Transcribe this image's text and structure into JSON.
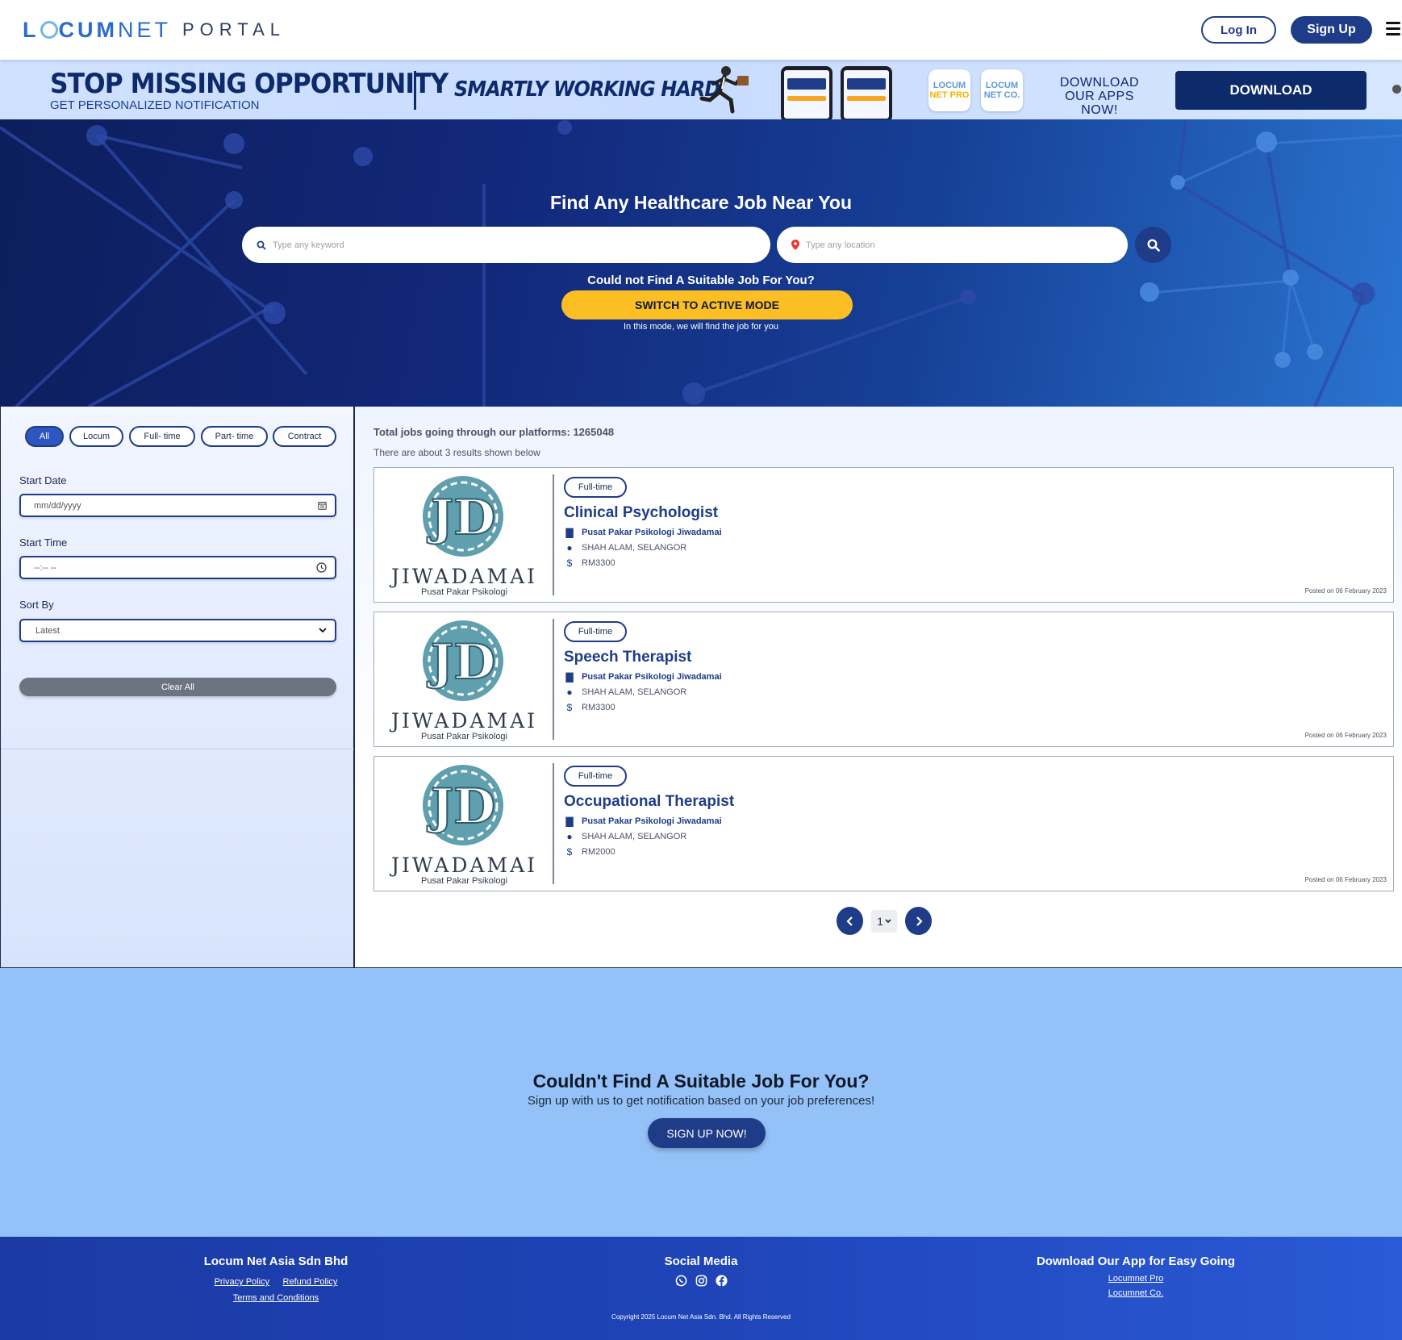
{
  "navbar": {
    "logo_locum": "L CUM",
    "logo_net": "NET",
    "logo_portal": "PORTAL",
    "login_label": "Log In",
    "signup_label": "Sign Up"
  },
  "promo": {
    "headline": "STOP MISSING OPPORTUNITY",
    "subline": "GET PERSONALIZED NOTIFICATION",
    "tagline": "SMARTLY WORKING HARD",
    "app1_line1": "LOCUM",
    "app1_line2": "NET PRO",
    "app2_line1": "LOCUM",
    "app2_line2": "NET CO.",
    "download_text_1": "DOWNLOAD",
    "download_text_2": "OUR APPS NOW!",
    "download_button": "DOWNLOAD"
  },
  "hero": {
    "title": "Find Any Healthcare Job Near You",
    "keyword_placeholder": "Type any keyword",
    "location_placeholder": "Type any location",
    "question": "Could not Find A Suitable Job For You?",
    "active_mode_button": "SWITCH TO ACTIVE MODE",
    "note": "In this mode, we will find the job for you"
  },
  "filters": {
    "types": [
      "All",
      "Locum",
      "Full- time",
      "Part- time",
      "Contract"
    ],
    "selected_type": "All",
    "start_date_label": "Start Date",
    "start_date_placeholder": "mm/dd/yyyy",
    "start_time_label": "Start Time",
    "start_time_placeholder": "--:-- --",
    "sort_label": "Sort By",
    "sort_value": "Latest",
    "clear_label": "Clear All"
  },
  "results": {
    "total_text": "Total jobs going through our platforms: 1265048",
    "about_text": "There are about 3 results shown below",
    "jobs": [
      {
        "type": "Full-time",
        "title": "Clinical Psychologist",
        "company": "Pusat Pakar Psikologi Jiwadamai",
        "location": "SHAH ALAM, SELANGOR",
        "salary": "RM3300",
        "posted": "Posted on 06 February 2023",
        "logo_brand": "JIWADAMAI",
        "logo_sub": "Pusat Pakar Psikologi"
      },
      {
        "type": "Full-time",
        "title": "Speech Therapist",
        "company": "Pusat Pakar Psikologi Jiwadamai",
        "location": "SHAH ALAM, SELANGOR",
        "salary": "RM3300",
        "posted": "Posted on 06 February 2023",
        "logo_brand": "JIWADAMAI",
        "logo_sub": "Pusat Pakar Psikologi"
      },
      {
        "type": "Full-time",
        "title": "Occupational Therapist",
        "company": "Pusat Pakar Psikologi Jiwadamai",
        "location": "SHAH ALAM, SELANGOR",
        "salary": "RM2000",
        "posted": "Posted on 06 February 2023",
        "logo_brand": "JIWADAMAI",
        "logo_sub": "Pusat Pakar Psikologi"
      }
    ],
    "page_value": "1"
  },
  "cta": {
    "title": "Couldn't Find A Suitable Job For You?",
    "subtitle": "Sign up with us to get notification based on your job preferences!",
    "button": "SIGN UP NOW!"
  },
  "footer": {
    "company": "Locum Net Asia Sdn Bhd",
    "privacy": "Privacy Policy",
    "refund": "Refund Policy",
    "terms": "Terms and Conditions",
    "social_title": "Social Media",
    "social_icons": [
      "whatsapp-icon",
      "instagram-icon",
      "facebook-icon"
    ],
    "download_title": "Download Our App for Easy Going",
    "app_pro": "Locumnet Pro",
    "app_co": "Locumnet Co.",
    "copyright": "Copyright 2025 Locum Net Asia Sdn. Bhd. All Rights Reserved"
  },
  "colors": {
    "brand_navy": "#1f3c88",
    "accent_yellow": "#fbbf24",
    "cta_bg": "#94c2f8"
  }
}
